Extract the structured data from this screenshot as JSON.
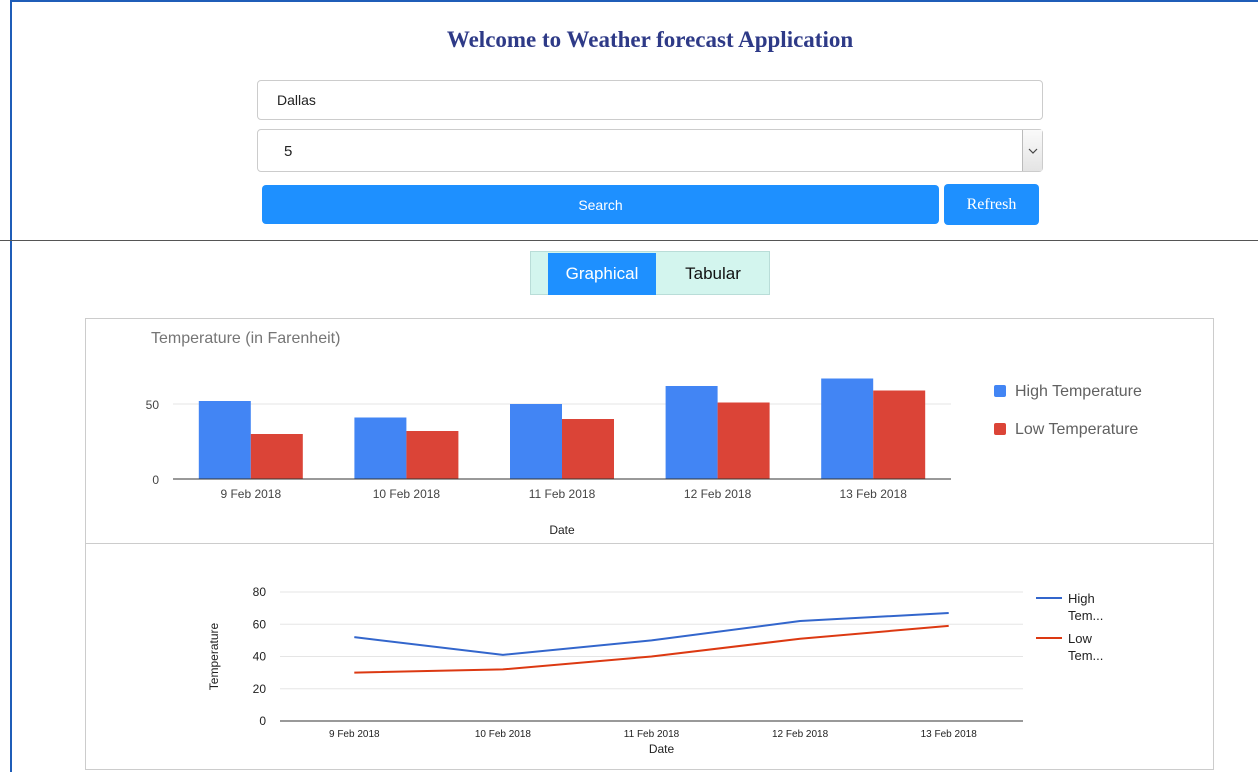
{
  "header": {
    "title": "Welcome to Weather forecast Application"
  },
  "search": {
    "city_value": "Dallas",
    "days_value": "5",
    "search_label": "Search",
    "refresh_label": "Refresh"
  },
  "view_toggle": {
    "graphical_label": "Graphical",
    "tabular_label": "Tabular",
    "active": "Graphical"
  },
  "colors": {
    "accent": "#1e90ff",
    "title": "#2e3a87",
    "high_bar": "#4285f4",
    "low_bar": "#db4437",
    "high_line": "#3366cc",
    "low_line": "#dc3912"
  },
  "chart_data": [
    {
      "type": "bar",
      "title": "Temperature (in Farenheit)",
      "xlabel": "Date",
      "ylabel": "",
      "categories": [
        "9 Feb 2018",
        "10 Feb 2018",
        "11 Feb 2018",
        "12 Feb 2018",
        "13 Feb 2018"
      ],
      "series": [
        {
          "name": "High Temperature",
          "values": [
            52,
            41,
            50,
            62,
            67
          ]
        },
        {
          "name": "Low Temperature",
          "values": [
            30,
            32,
            40,
            51,
            59
          ]
        }
      ],
      "yticks": [
        0,
        50
      ],
      "ylim": [
        0,
        70
      ],
      "legend": "right",
      "grid": true
    },
    {
      "type": "line",
      "title": "",
      "xlabel": "Date",
      "ylabel": "Temperature",
      "categories": [
        "9 Feb 2018",
        "10 Feb 2018",
        "11 Feb 2018",
        "12 Feb 2018",
        "13 Feb 2018"
      ],
      "series": [
        {
          "name": "High Temperature",
          "legend_lines": [
            "High",
            "Tem..."
          ],
          "values": [
            52,
            41,
            50,
            62,
            67
          ]
        },
        {
          "name": "Low Temperature",
          "legend_lines": [
            "Low",
            "Tem..."
          ],
          "values": [
            30,
            32,
            40,
            51,
            59
          ]
        }
      ],
      "yticks": [
        0,
        20,
        40,
        60,
        80
      ],
      "ylim": [
        0,
        80
      ],
      "legend": "right",
      "grid": true
    }
  ]
}
